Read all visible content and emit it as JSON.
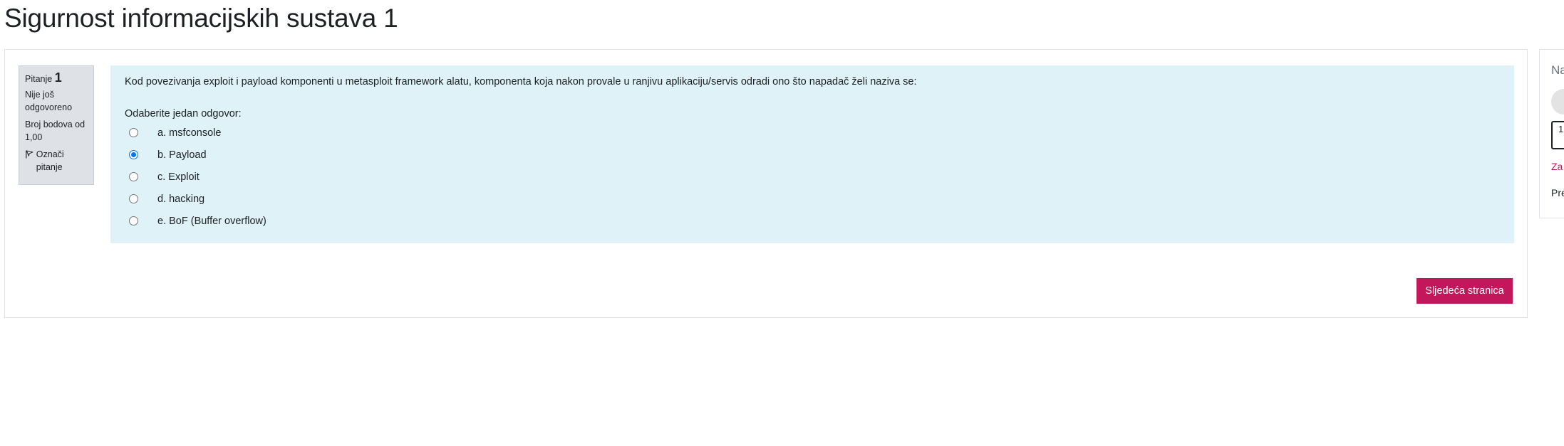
{
  "page": {
    "title": "Sigurnost informacijskih sustava 1"
  },
  "question_info": {
    "label": "Pitanje",
    "number": "1",
    "status": "Nije još odgovoreno",
    "marks": "Broj bodova od 1,00",
    "flag_label": "Označi pitanje"
  },
  "question": {
    "text": "Kod povezivanja exploit i payload komponenti u metasploit framework alatu, komponenta koja nakon provale u ranjivu aplikaciju/servis odradi ono što napadač želi naziva se:",
    "prompt": "Odaberite jedan odgovor:",
    "answers": [
      {
        "label": "a. msfconsole",
        "checked": false
      },
      {
        "label": "b. Payload",
        "checked": true
      },
      {
        "label": "c. Exploit",
        "checked": false
      },
      {
        "label": "d. hacking",
        "checked": false
      },
      {
        "label": "e. BoF (Buffer overflow)",
        "checked": false
      }
    ]
  },
  "buttons": {
    "next": "Sljedeća stranica"
  },
  "side_panel": {
    "title": "Na",
    "qnav_number": "1",
    "finish_link": "Za",
    "preview_link": "Pre"
  },
  "colors": {
    "accent": "#c2185b",
    "formulation_bg": "#def2f8",
    "info_bg": "#dee2e6",
    "radio_checked": "#0075ff"
  }
}
